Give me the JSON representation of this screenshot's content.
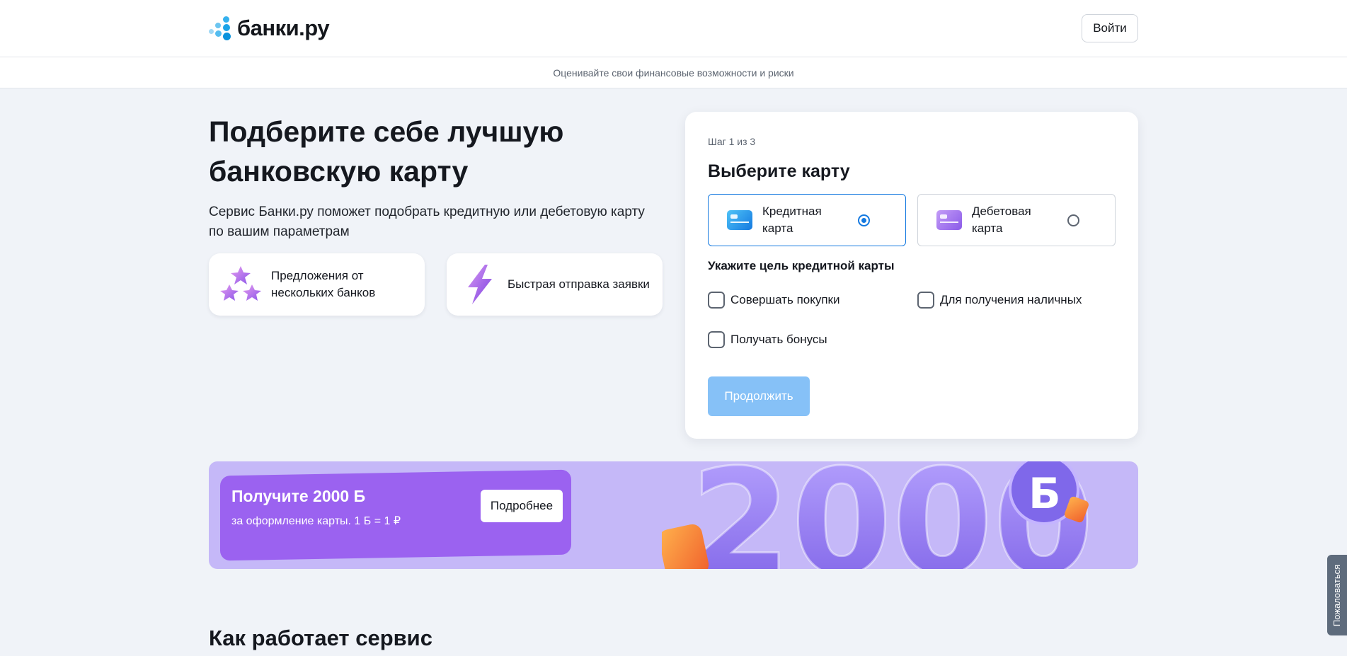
{
  "header": {
    "logo_text": "банки.ру",
    "login_label": "Войти"
  },
  "subbar": {
    "text": "Оценивайте свои финансовые возможности и риски"
  },
  "hero": {
    "title": "Подберите себе лучшую банковскую карту",
    "description": "Сервис Банки.ру поможет подобрать кредитную или дебетовую карту по вашим параметрам",
    "features": [
      {
        "text": "Предложения от нескольких банков",
        "icon": "stars-icon"
      },
      {
        "text": "Быстрая отправка заявки",
        "icon": "lightning-icon"
      }
    ]
  },
  "form": {
    "step": "Шаг 1 из 3",
    "title": "Выберите карту",
    "options": [
      {
        "label": "Кредитная карта",
        "selected": true,
        "icon": "credit-card-icon"
      },
      {
        "label": "Дебетовая карта",
        "selected": false,
        "icon": "debit-card-icon"
      }
    ],
    "purpose_title": "Укажите цель кредитной карты",
    "purposes": [
      {
        "label": "Совершать покупки",
        "checked": false
      },
      {
        "label": "Для получения наличных",
        "checked": false
      },
      {
        "label": "Получать бонусы",
        "checked": false
      }
    ],
    "continue_label": "Продолжить"
  },
  "promo": {
    "title": "Получите 2000 Б",
    "subtitle": "за оформление карты. 1 Б = 1 ₽",
    "more_label": "Подробнее",
    "graphic_text": "2000",
    "badge_text": "Б"
  },
  "how": {
    "title": "Как работает сервис"
  },
  "complain": {
    "label": "Пожаловаться"
  },
  "colors": {
    "accent": "#1479e0",
    "continue_disabled": "#86c1f7",
    "promo_bg": "#c5b8f8",
    "promo_box": "#9b62f0"
  }
}
